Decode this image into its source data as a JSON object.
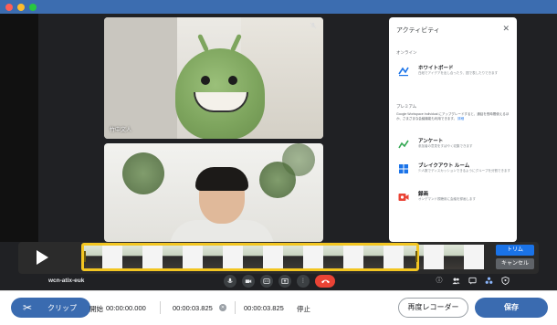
{
  "window": {
    "title": ""
  },
  "participants": [
    {
      "name": "竹中文人"
    }
  ],
  "activity_panel": {
    "title": "アクティビティ",
    "section_online": "オンライン",
    "items_top": [
      {
        "title": "ホワイトボード",
        "description": "白紙でアイデアを出し合ったり、図で表したりできます",
        "icon": "whiteboard-icon"
      }
    ],
    "section_premium": "プレミアム",
    "premium_note": "Google Workspace Individual にアップグレードすると、通話を長時間使えるほか、さまざまな会議機能も利用できます。",
    "premium_link": "詳細",
    "items_premium": [
      {
        "title": "アンケート",
        "description": "参加者の意見をすばやく収集できます",
        "icon": "poll-icon"
      },
      {
        "title": "ブレイクアウト ルーム",
        "description": "少人数でディスカッションできるようにグループを分割できます",
        "icon": "breakout-icon"
      },
      {
        "title": "録画",
        "description": "オンデマンド視聴用に会議を録画します",
        "icon": "record-icon"
      }
    ]
  },
  "trim": {
    "trim_label": "トリム",
    "cancel_label": "キャンセル"
  },
  "meeting": {
    "code": "wcn-atix-euk"
  },
  "toolbar": {
    "clip_label": "クリップ",
    "start_label": "開始",
    "start_time": "00:00:00.000",
    "current_time": "00:00:03.825",
    "stop_time": "00:00:03.825",
    "stop_label": "停止",
    "rerecord_label": "再度レコーダー",
    "save_label": "保存"
  },
  "colors": {
    "accent": "#3a6bb0",
    "trim_selection": "#f3c622",
    "end_call": "#ea4335",
    "titlebar": "#3c6db0"
  }
}
